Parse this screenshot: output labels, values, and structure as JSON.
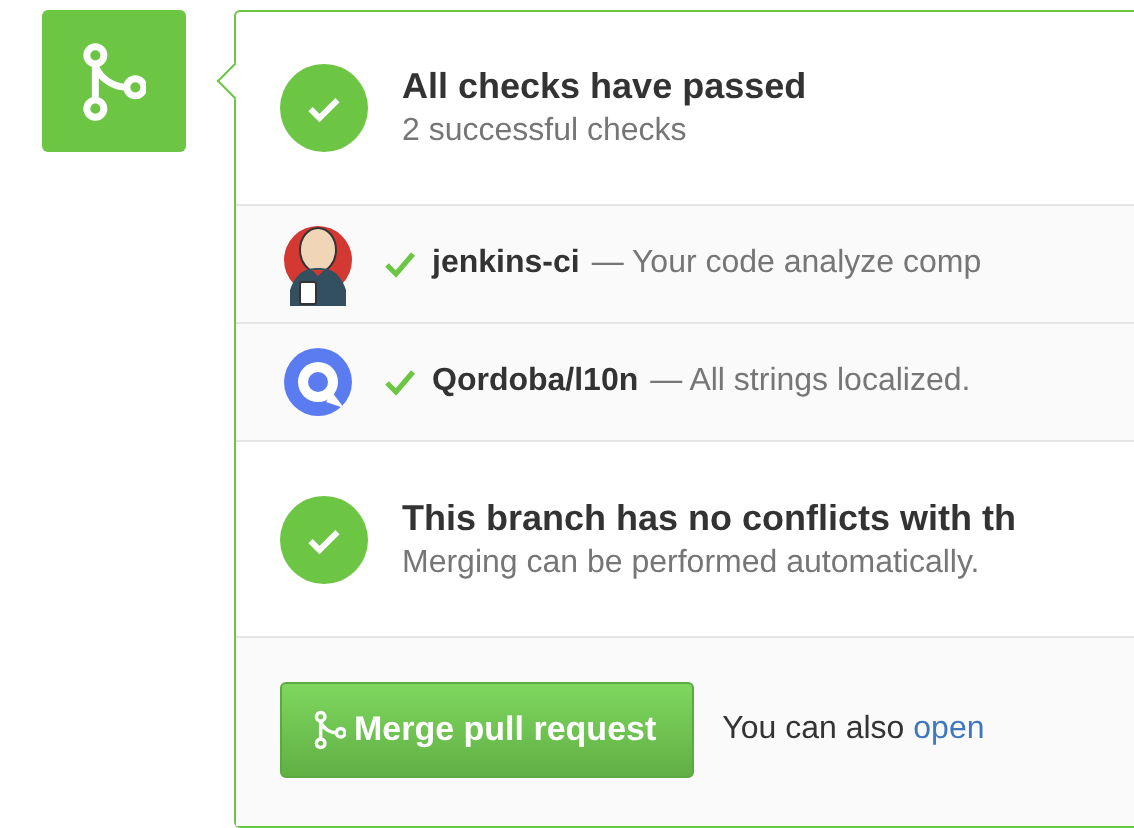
{
  "summary": {
    "passed": true,
    "title": "All checks have passed",
    "subtitle": "2 successful checks"
  },
  "checks": [
    {
      "kind": "jenkins",
      "passed": true,
      "name": "jenkins-ci",
      "description": "— Your code analyze comp"
    },
    {
      "kind": "qordoba",
      "passed": true,
      "name": "Qordoba/l10n",
      "description": "— All strings localized."
    }
  ],
  "merge_status": {
    "passed": true,
    "title": "This branch has no conflicts with th",
    "subtitle": "Merging can be performed automatically."
  },
  "merge_button": {
    "label": "Merge pull request"
  },
  "footer": {
    "text": "You can also",
    "link": "open"
  }
}
